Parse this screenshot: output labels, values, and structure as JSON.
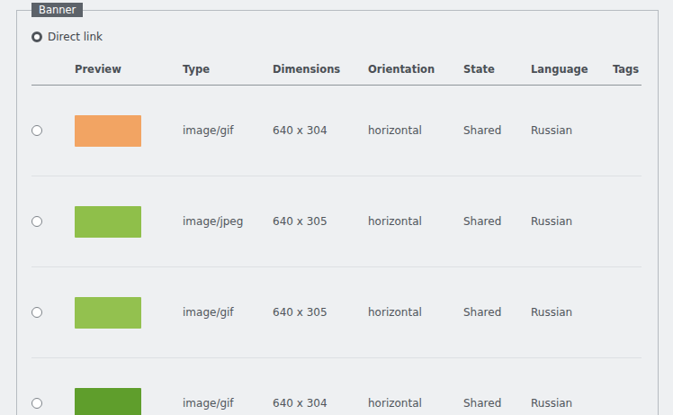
{
  "panel": {
    "legend": "Banner"
  },
  "source_options": [
    {
      "label": "Direct link",
      "selected": true
    }
  ],
  "table": {
    "columns": [
      "Preview",
      "Type",
      "Dimensions",
      "Orientation",
      "State",
      "Language",
      "Tags"
    ],
    "rows": [
      {
        "selected": false,
        "color": "#f2a463",
        "type": "image/gif",
        "dimensions": "640 x 304",
        "orientation": "horizontal",
        "state": "Shared",
        "language": "Russian"
      },
      {
        "selected": false,
        "color": "#8fbf4a",
        "type": "image/jpeg",
        "dimensions": "640 x 305",
        "orientation": "horizontal",
        "state": "Shared",
        "language": "Russian"
      },
      {
        "selected": false,
        "color": "#93c14f",
        "type": "image/gif",
        "dimensions": "640 x 305",
        "orientation": "horizontal",
        "state": "Shared",
        "language": "Russian"
      },
      {
        "selected": false,
        "color": "#5f9e2c",
        "type": "image/gif",
        "dimensions": "640 x 304",
        "orientation": "horizontal",
        "state": "Shared",
        "language": "Russian"
      }
    ]
  }
}
